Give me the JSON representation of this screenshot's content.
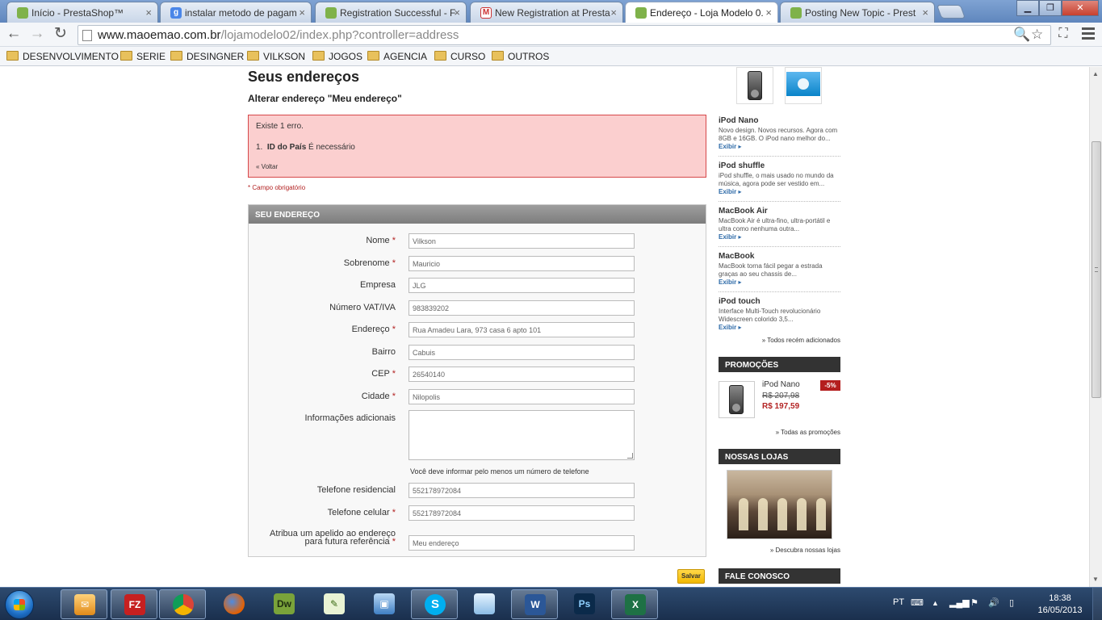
{
  "browser": {
    "tabs": [
      {
        "title": "Início - PrestaShop™",
        "icon": "prestashop-icon"
      },
      {
        "title": "instalar metodo de pagam",
        "icon": "google-icon"
      },
      {
        "title": "Registration Successful - F",
        "icon": "prestashop-icon"
      },
      {
        "title": "New Registration at Presta",
        "icon": "gmail-icon"
      },
      {
        "title": "Endereço - Loja Modelo 0.",
        "icon": "prestashop-icon",
        "active": true
      },
      {
        "title": "Posting New Topic - Prest",
        "icon": "prestashop-icon"
      }
    ],
    "url_host": "www.maoemao.com.br",
    "url_path": "/lojamodelo02/index.php?controller=address",
    "bookmarks": [
      "DESENVOLVIMENTO",
      "SERIE",
      "DESINGNER",
      "VILKSON",
      "JOGOS",
      "AGENCIA",
      "CURSO",
      "OUTROS"
    ]
  },
  "page": {
    "title": "Seus endereços",
    "subtitle": "Alterar endereço \"Meu endereço\"",
    "error": {
      "count": "Existe 1 erro.",
      "item_num": "1.",
      "item_field": "ID do País",
      "item_text": "É necessário",
      "back": "« Voltar"
    },
    "required_note": "* Campo obrigatório",
    "form": {
      "header": "SEU ENDEREÇO",
      "fields": [
        {
          "label": "Nome",
          "required": true,
          "value": "Vilkson"
        },
        {
          "label": "Sobrenome",
          "required": true,
          "value": "Mauricio"
        },
        {
          "label": "Empresa",
          "required": false,
          "value": "JLG"
        },
        {
          "label": "Número VAT/IVA",
          "required": false,
          "value": "983839202"
        },
        {
          "label": "Endereço",
          "required": true,
          "value": "Rua Amadeu Lara, 973 casa 6 apto 101"
        },
        {
          "label": "Bairro",
          "required": false,
          "value": "Cabuis"
        },
        {
          "label": "CEP",
          "required": true,
          "value": "26540140"
        },
        {
          "label": "Cidade",
          "required": true,
          "value": "Nilopolis"
        }
      ],
      "info_label": "Informações adicionais",
      "phone_note": "Você deve informar pelo menos um número de telefone",
      "phone_home_label": "Telefone residencial",
      "phone_home_value": "552178972084",
      "phone_mobile_label": "Telefone celular",
      "phone_mobile_value": "552178972084",
      "alias_label_1": "Atribua um apelido ao endereço",
      "alias_label_2": "para futura referência",
      "alias_value": "Meu endereço",
      "star": "*",
      "save": "Salvar"
    }
  },
  "sidebar": {
    "new_products": [
      {
        "name": "iPod Nano",
        "desc": "Novo design. Novos recursos. Agora com 8GB e 16GB. O iPod nano melhor do...",
        "more": "Exibir ▸"
      },
      {
        "name": "iPod shuffle",
        "desc": "iPod shuffle, o mais usado no mundo da música, agora pode ser vestido em...",
        "more": "Exibir ▸"
      },
      {
        "name": "MacBook Air",
        "desc": "MacBook Air é ultra-fino, ultra-portátil e ultra como nenhuma outra...",
        "more": "Exibir ▸"
      },
      {
        "name": "MacBook",
        "desc": "MacBook torna fácil pegar a estrada graças ao seu chassis de...",
        "more": "Exibir ▸"
      },
      {
        "name": "iPod touch",
        "desc": "Interface Multi-Touch revolucionário Widescreen colorido 3,5...",
        "more": "Exibir ▸"
      }
    ],
    "all_new": "» Todos recém adicionados",
    "promotions_header": "PROMOÇÕES",
    "promo": {
      "name": "iPod Nano",
      "old_price": "R$ 207,98",
      "new_price": "R$ 197,59",
      "discount": "-5%"
    },
    "all_promos": "» Todas as promoções",
    "stores_header": "NOSSAS LOJAS",
    "discover_stores": "» Descubra nossas lojas",
    "contact_header": "FALE CONOSCO"
  },
  "taskbar": {
    "apps": [
      "thunderbird",
      "filezilla",
      "chrome",
      "firefox",
      "dreamweaver",
      "notepad++",
      "virtualbox",
      "skype",
      "notes",
      "word",
      "photoshop",
      "excel"
    ],
    "labels": {
      "filezilla": "FZ",
      "dreamweaver": "Dw",
      "photoshop": "Ps",
      "word": "W",
      "excel": "X"
    },
    "language": "PT",
    "time": "18:38",
    "date": "16/05/2013"
  }
}
